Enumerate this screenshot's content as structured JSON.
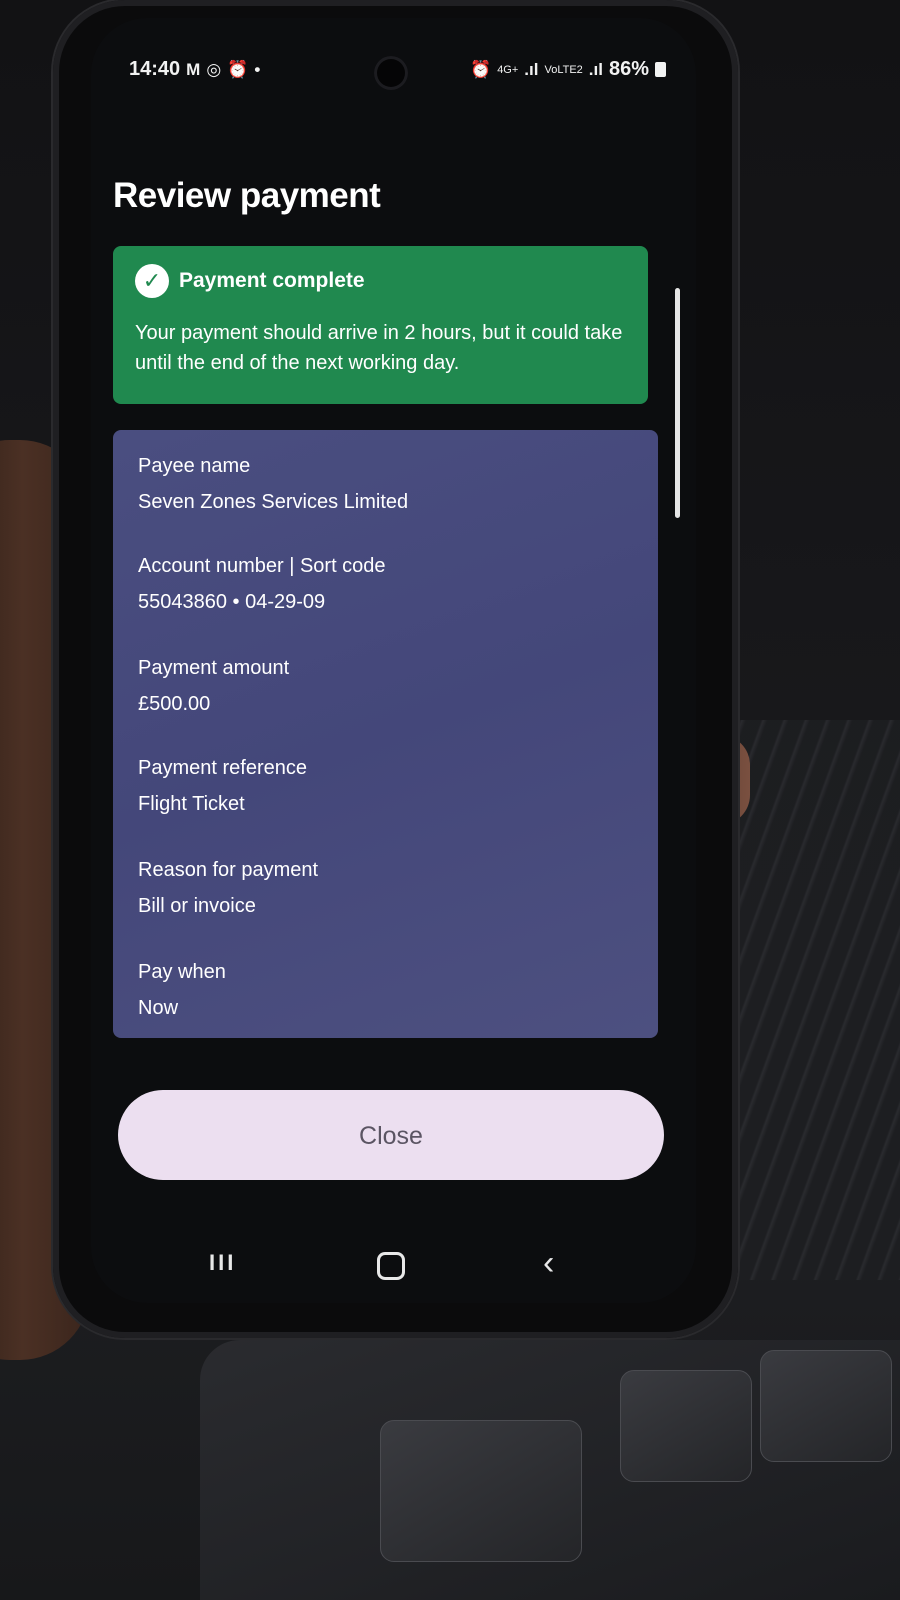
{
  "status_bar": {
    "time": "14:40",
    "notification_icons": [
      "M",
      "◎",
      "⏰",
      "•"
    ],
    "network": "4G+",
    "volte": "VoLTE2",
    "battery": "86%"
  },
  "page": {
    "title": "Review payment"
  },
  "success_banner": {
    "heading": "Payment complete",
    "message": "Your payment should arrive in 2 hours, but it could take until the end of the next working day.",
    "color": "#20894f"
  },
  "details": [
    {
      "label": "Payee name",
      "value": "Seven Zones Services Limited"
    },
    {
      "label": "Account number | Sort code",
      "value": "55043860 • 04-29-09"
    },
    {
      "label": "Payment amount",
      "value": "£500.00"
    },
    {
      "label": "Payment reference",
      "value": "Flight Ticket"
    },
    {
      "label": "Reason for payment",
      "value": "Bill or invoice"
    },
    {
      "label": "Pay when",
      "value": "Now"
    }
  ],
  "actions": {
    "close_label": "Close"
  },
  "nav": {
    "recents": "III",
    "back": "‹"
  },
  "colors": {
    "card_background": "#474b7a",
    "close_button_background": "#ecdff0"
  }
}
